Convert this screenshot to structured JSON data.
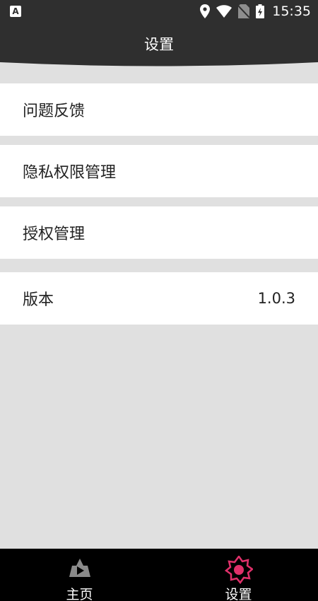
{
  "status_bar": {
    "app_badge": "A",
    "time": "15:35"
  },
  "header": {
    "title": "设置"
  },
  "settings": {
    "items": [
      {
        "label": "问题反馈",
        "value": ""
      },
      {
        "label": "隐私权限管理",
        "value": ""
      },
      {
        "label": "授权管理",
        "value": ""
      },
      {
        "label": "版本",
        "value": "1.0.3"
      }
    ]
  },
  "bottom_nav": {
    "tabs": [
      {
        "label": "主页",
        "icon": "home-play-icon",
        "active": false
      },
      {
        "label": "设置",
        "icon": "gear-icon",
        "active": true
      }
    ]
  },
  "colors": {
    "header_bg": "#2f2f2f",
    "page_bg": "#e0e0e0",
    "nav_bg": "#000000",
    "active_icon": "#e0306a",
    "inactive_icon": "#8a8a8a"
  }
}
